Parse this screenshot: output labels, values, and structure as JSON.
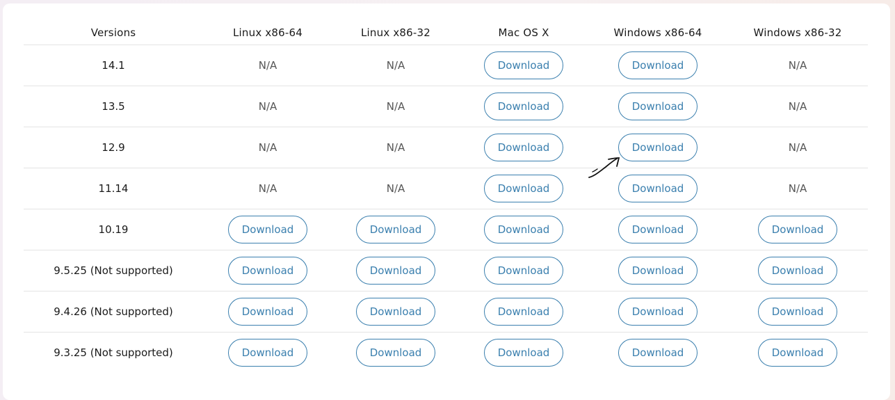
{
  "table": {
    "headers": [
      "Versions",
      "Linux x86-64",
      "Linux x86-32",
      "Mac OS X",
      "Windows x86-64",
      "Windows x86-32"
    ],
    "rows": [
      {
        "version": "14.1",
        "cells": [
          "N/A",
          "N/A",
          "Download",
          "Download",
          "N/A"
        ]
      },
      {
        "version": "13.5",
        "cells": [
          "N/A",
          "N/A",
          "Download",
          "Download",
          "N/A"
        ]
      },
      {
        "version": "12.9",
        "cells": [
          "N/A",
          "N/A",
          "Download",
          "Download",
          "N/A"
        ]
      },
      {
        "version": "11.14",
        "cells": [
          "N/A",
          "N/A",
          "Download",
          "Download",
          "N/A"
        ]
      },
      {
        "version": "10.19",
        "cells": [
          "Download",
          "Download",
          "Download",
          "Download",
          "Download"
        ]
      },
      {
        "version": "9.5.25 (Not supported)",
        "cells": [
          "Download",
          "Download",
          "Download",
          "Download",
          "Download"
        ]
      },
      {
        "version": "9.4.26 (Not supported)",
        "cells": [
          "Download",
          "Download",
          "Download",
          "Download",
          "Download"
        ]
      },
      {
        "version": "9.3.25 (Not supported)",
        "cells": [
          "Download",
          "Download",
          "Download",
          "Download",
          "Download"
        ]
      }
    ]
  },
  "colors": {
    "accent": "#3a7fae",
    "divider": "#e4e4e4"
  },
  "icons": {
    "annotation": "hand-drawn-arrow-icon"
  }
}
